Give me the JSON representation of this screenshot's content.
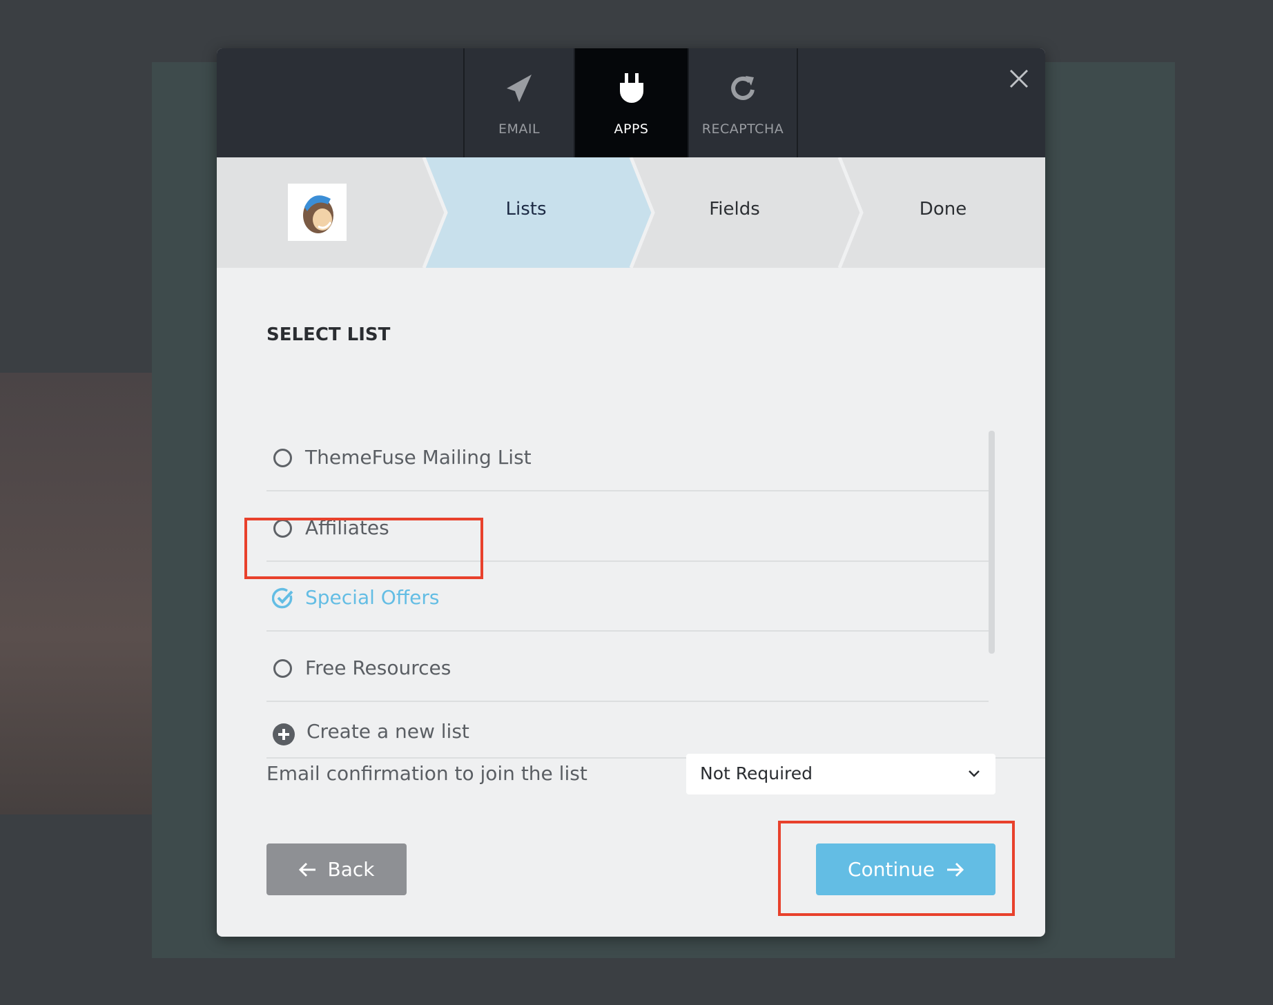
{
  "tabs": [
    {
      "label": "EMAIL",
      "icon": "paper-plane-icon"
    },
    {
      "label": "APPS",
      "icon": "plug-icon",
      "active": true
    },
    {
      "label": "RECAPTCHA",
      "icon": "refresh-icon"
    }
  ],
  "steps": [
    {
      "label": "Lists",
      "active": true
    },
    {
      "label": "Fields"
    },
    {
      "label": "Done"
    }
  ],
  "section_title": "SELECT LIST",
  "lists": [
    {
      "label": "ThemeFuse Mailing List",
      "selected": false
    },
    {
      "label": "Affiliates",
      "selected": false
    },
    {
      "label": "Special Offers",
      "selected": true
    },
    {
      "label": "Free Resources",
      "selected": false
    }
  ],
  "create_label": "Create a new list",
  "confirm_label": "Email confirmation to join the list",
  "confirm_value": "Not Required",
  "back_label": "Back",
  "continue_label": "Continue",
  "colors": {
    "accent": "#63bde4",
    "highlight": "#e8412c",
    "active_step": "#c8e0ec"
  }
}
